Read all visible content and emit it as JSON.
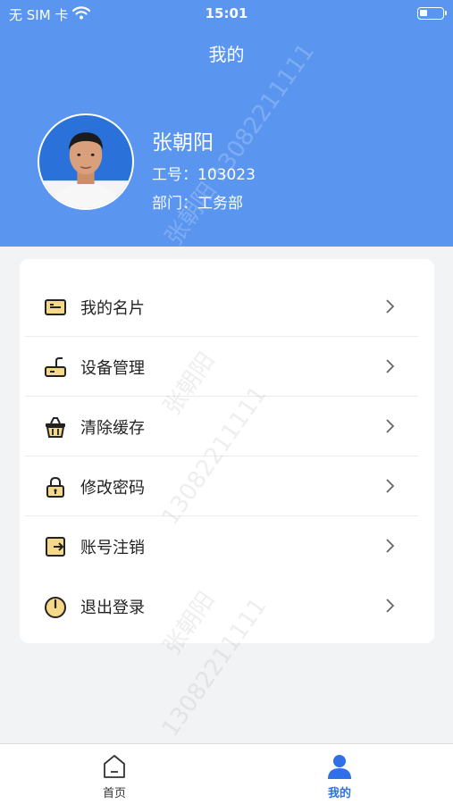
{
  "status_bar": {
    "carrier": "无 SIM 卡",
    "time": "15:01"
  },
  "header": {
    "title": "我的"
  },
  "profile": {
    "name": "张朝阳",
    "id_label": "工号：",
    "id_value": "103023",
    "dept_label": "部门：",
    "dept_value": "工务部"
  },
  "menu": {
    "items": [
      {
        "label": "我的名片",
        "icon": "id-card-icon"
      },
      {
        "label": "设备管理",
        "icon": "router-icon"
      },
      {
        "label": "清除缓存",
        "icon": "basket-icon"
      },
      {
        "label": "修改密码",
        "icon": "lock-icon"
      },
      {
        "label": "账号注销",
        "icon": "logout-box-icon"
      },
      {
        "label": "退出登录",
        "icon": "power-icon"
      }
    ]
  },
  "tabbar": {
    "tabs": [
      {
        "label": "首页",
        "icon": "home-icon",
        "active": false
      },
      {
        "label": "我的",
        "icon": "user-icon",
        "active": true
      }
    ]
  },
  "watermark": {
    "name": "张朝阳",
    "phone": "13082211111"
  },
  "colors": {
    "header": "#5a95ef",
    "accent": "#2f6fe8",
    "icon_fill": "#f4d98a",
    "background": "#f2f3f5"
  }
}
